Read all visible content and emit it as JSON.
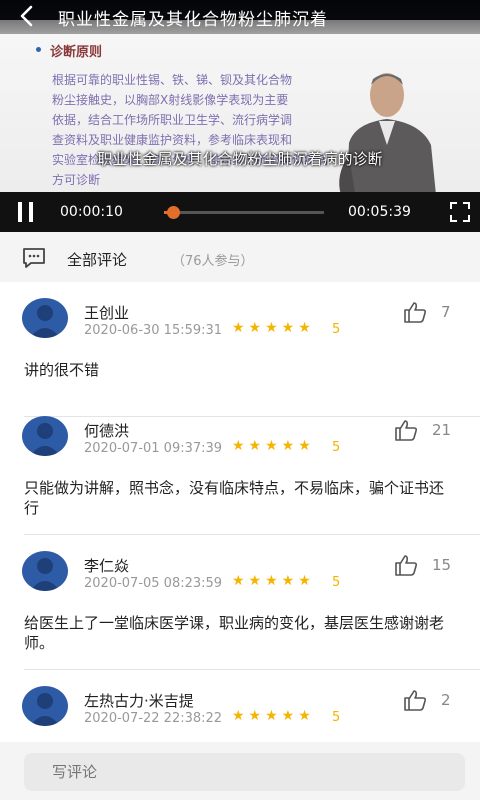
{
  "video": {
    "title": "职业性金属及其化合物粉尘肺沉着",
    "subtitle": "职业性金属及其化合物粉尘肺沉着病的诊断",
    "slide": {
      "heading": "诊断原则",
      "lines": [
        "根据可靠的职业性锡、铁、锑、钡及其化合物",
        "粉尘接触史，以胸部X射线影像学表现为主要",
        "依据，结合工作场所职业卫生学、流行病学调",
        "查资料及职业健康监护资料，参考临床表现和",
        "实验室检查结果，综合分析，排除其他肺部类似疾病后，",
        "方可诊断"
      ]
    },
    "current_time": "00:00:10",
    "total_time": "00:05:39",
    "progress": 0.03
  },
  "comments": {
    "title": "全部评论",
    "participants": "（76人参与）",
    "items": [
      {
        "name": "王创业",
        "date": "2020-06-30 15:59:31",
        "stars": "★★★★★",
        "score": "5",
        "likes": "7",
        "text": "讲的很不错"
      },
      {
        "name": "何德洪",
        "date": "2020-07-01 09:37:39",
        "stars": "★★★★★",
        "score": "5",
        "likes": "21",
        "text": "只能做为讲解，照书念，没有临床特点，不易临床，骗个证书还行"
      },
      {
        "name": "李仁焱",
        "date": "2020-07-05 08:23:59",
        "stars": "★★★★★",
        "score": "5",
        "likes": "15",
        "text": "给医生上了一堂临床医学课，职业病的变化，基层医生感谢谢老师。"
      },
      {
        "name": "左热古力·米吉提",
        "date": "2020-07-22 22:38:22",
        "stars": "★★★★★",
        "score": "5",
        "likes": "2",
        "text": ""
      }
    ]
  },
  "input": {
    "placeholder": "写评论"
  },
  "colors": {
    "accent": "#e36d2a",
    "star": "#f4b400",
    "avatar": "#2d5ba6"
  }
}
